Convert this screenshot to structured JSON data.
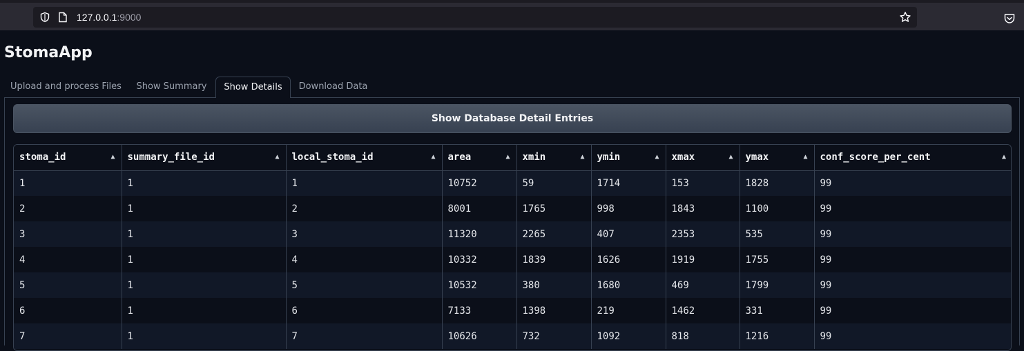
{
  "browser": {
    "url_host": "127.0.0.1",
    "url_port": ":9000"
  },
  "app": {
    "title": "StomaApp"
  },
  "tabs": [
    {
      "label": "Upload and process Files"
    },
    {
      "label": "Show Summary"
    },
    {
      "label": "Show Details"
    },
    {
      "label": "Download Data"
    }
  ],
  "active_tab": "Show Details",
  "action_button": {
    "label": "Show Database Detail Entries"
  },
  "table": {
    "columns": [
      "stoma_id",
      "summary_file_id",
      "local_stoma_id",
      "area",
      "xmin",
      "ymin",
      "xmax",
      "ymax",
      "conf_score_per_cent"
    ],
    "sort_glyph": "▲",
    "rows": [
      [
        "1",
        "1",
        "1",
        "10752",
        "59",
        "1714",
        "153",
        "1828",
        "99"
      ],
      [
        "2",
        "1",
        "2",
        "8001",
        "1765",
        "998",
        "1843",
        "1100",
        "99"
      ],
      [
        "3",
        "1",
        "3",
        "11320",
        "2265",
        "407",
        "2353",
        "535",
        "99"
      ],
      [
        "4",
        "1",
        "4",
        "10332",
        "1839",
        "1626",
        "1919",
        "1755",
        "99"
      ],
      [
        "5",
        "1",
        "5",
        "10532",
        "380",
        "1680",
        "469",
        "1799",
        "99"
      ],
      [
        "6",
        "1",
        "6",
        "7133",
        "1398",
        "219",
        "1462",
        "331",
        "99"
      ],
      [
        "7",
        "1",
        "7",
        "10626",
        "732",
        "1092",
        "818",
        "1216",
        "99"
      ]
    ]
  },
  "icons": {
    "tracking_protection": "shield-icon",
    "page_info": "page-icon",
    "bookmark": "star-icon",
    "pocket": "pocket-icon"
  }
}
